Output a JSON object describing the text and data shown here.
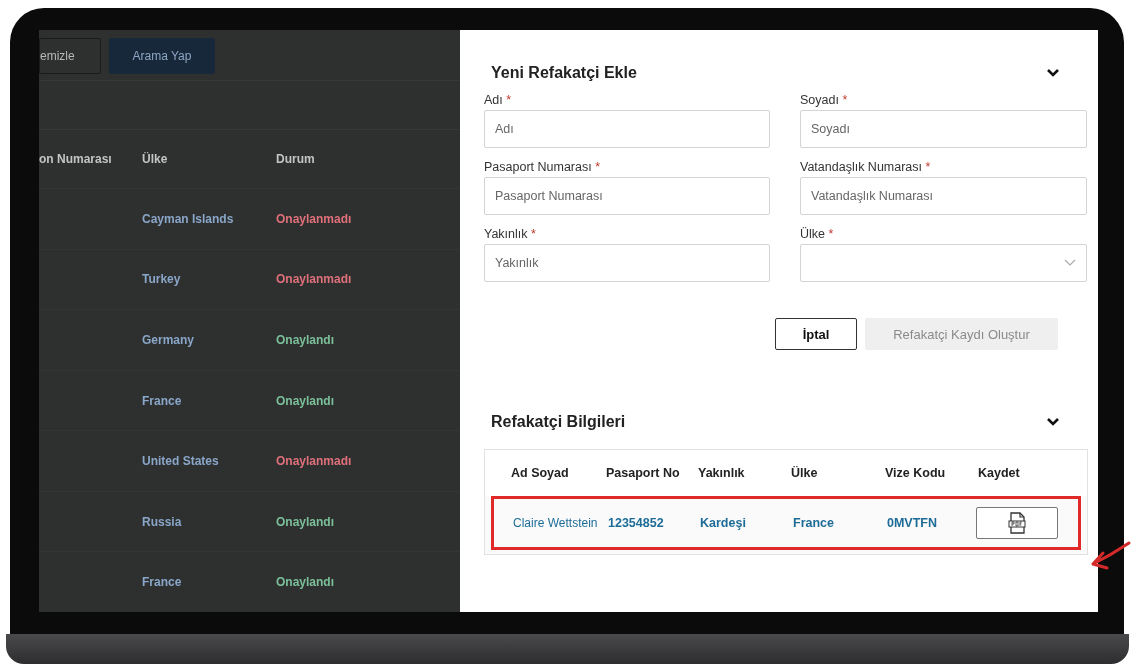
{
  "background": {
    "buttons": [
      {
        "label": "emizle",
        "kind": "outline"
      },
      {
        "label": "Arama Yap",
        "kind": "primary"
      }
    ],
    "columns": [
      "on Numarası",
      "Ülke",
      "Durum"
    ],
    "rows": [
      {
        "country": "Cayman Islands",
        "status": "Onaylanmadı",
        "approved": false
      },
      {
        "country": "Turkey",
        "status": "Onaylanmadı",
        "approved": false
      },
      {
        "country": "Germany",
        "status": "Onaylandı",
        "approved": true
      },
      {
        "country": "France",
        "status": "Onaylandı",
        "approved": true
      },
      {
        "country": "United States",
        "status": "Onaylanmadı",
        "approved": false
      },
      {
        "country": "Russia",
        "status": "Onaylandı",
        "approved": true
      },
      {
        "country": "France",
        "status": "Onaylandı",
        "approved": true
      }
    ]
  },
  "form": {
    "title": "Yeni Refakatçi Ekle",
    "expanded": true,
    "fields": [
      {
        "label": "Adı",
        "required": "*",
        "placeholder": "Adı",
        "kind": "text"
      },
      {
        "label": "Soyadı",
        "required": "*",
        "placeholder": "Soyadı",
        "kind": "text"
      },
      {
        "label": "Pasaport Numarası",
        "required": "*",
        "placeholder": "Pasaport Numarası",
        "kind": "text"
      },
      {
        "label": "Vatandaşlık Numarası",
        "required": "*",
        "placeholder": "Vatandaşlık Numarası",
        "kind": "text"
      },
      {
        "label": "Yakınlık",
        "required": "*",
        "placeholder": "Yakınlık",
        "kind": "text"
      },
      {
        "label": "Ülke",
        "required": "*",
        "kind": "select"
      }
    ],
    "buttons": [
      {
        "label": "İptal",
        "disabled": false
      },
      {
        "label": "Refakatçi Kaydı Oluştur",
        "disabled": true
      }
    ]
  },
  "companions": {
    "title": "Refakatçi Bilgileri",
    "expanded": true,
    "columns": [
      "Ad Soyad",
      "Pasaport No",
      "Yakınlık",
      "Ülke",
      "Vize Kodu",
      "Kaydet"
    ],
    "rows": [
      {
        "name": "Claire Wettstein",
        "passport": "12354852",
        "relation": "Kardeşi",
        "country": "France",
        "visa_code": "0MVTFN",
        "highlighted": true
      }
    ]
  }
}
